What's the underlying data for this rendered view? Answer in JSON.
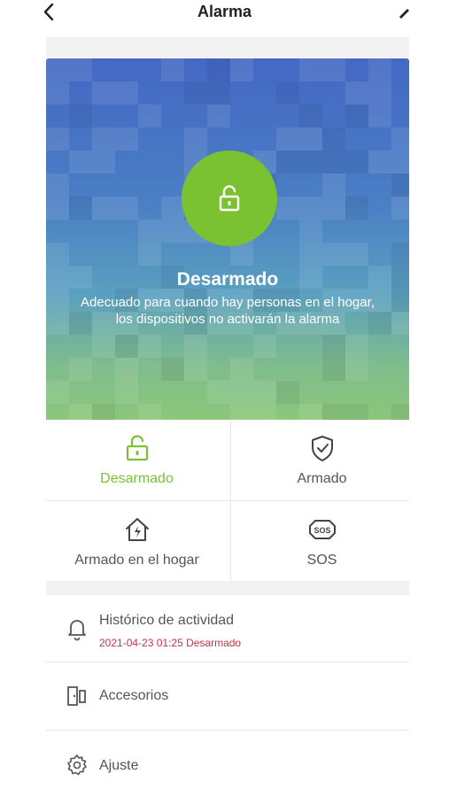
{
  "header": {
    "title": "Alarma"
  },
  "hero": {
    "status_title": "Desarmado",
    "description": "Adecuado para cuando hay personas en el hogar, los dispositivos no activarán la alarma"
  },
  "modes": [
    {
      "label": "Desarmado",
      "icon": "unlock-icon",
      "active": true
    },
    {
      "label": "Armado",
      "icon": "shield-check-icon",
      "active": false
    },
    {
      "label": "Armado en el hogar",
      "icon": "home-bolt-icon",
      "active": false
    },
    {
      "label": "SOS",
      "icon": "sos-icon",
      "active": false
    }
  ],
  "menu": {
    "history": {
      "label": "Histórico de actividad",
      "last_event": "2021-04-23 01:25 Desarmado"
    },
    "accessories": {
      "label": "Accesorios"
    },
    "settings": {
      "label": "Ajuste"
    }
  },
  "colors": {
    "accent_green": "#7ac231",
    "event_red": "#c8324a"
  }
}
